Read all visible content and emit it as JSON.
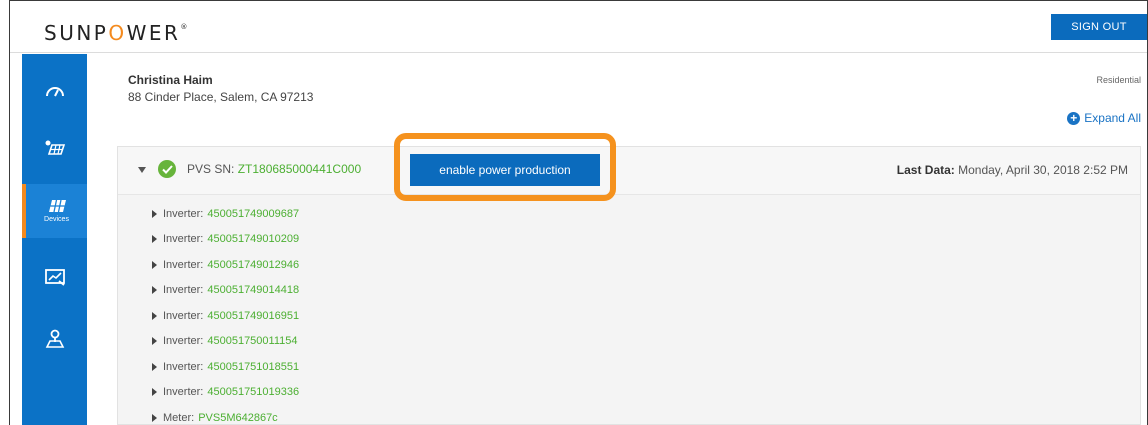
{
  "header": {
    "logo_pre": "SUNP",
    "logo_o": "O",
    "logo_post": "WER",
    "logo_reg": "®",
    "signout_label": "SIGN OUT"
  },
  "sidebar": {
    "items": [
      {
        "icon": "dashboard-gauge-icon",
        "label": ""
      },
      {
        "icon": "solar-panel-icon",
        "label": ""
      },
      {
        "icon": "devices-icon",
        "label": "Devices",
        "active": true
      },
      {
        "icon": "monitor-chart-icon",
        "label": ""
      },
      {
        "icon": "site-location-icon",
        "label": ""
      }
    ]
  },
  "customer": {
    "name": "Christina Haim",
    "address": "88 Cinder Place, Salem, CA 97213",
    "type": "Residential"
  },
  "actions": {
    "expand_all": "Expand All",
    "enable_power": "enable power production"
  },
  "pvs": {
    "label": "PVS SN: ",
    "serial": "ZT180685000441C000",
    "last_data_label": "Last Data:",
    "last_data_value": " Monday, April 30, 2018 2:52 PM"
  },
  "devices": [
    {
      "label": "Inverter:",
      "serial": "450051749009687"
    },
    {
      "label": "Inverter:",
      "serial": "450051749010209"
    },
    {
      "label": "Inverter:",
      "serial": "450051749012946"
    },
    {
      "label": "Inverter:",
      "serial": "450051749014418"
    },
    {
      "label": "Inverter:",
      "serial": "450051749016951"
    },
    {
      "label": "Inverter:",
      "serial": "450051750011154"
    },
    {
      "label": "Inverter:",
      "serial": "450051751018551"
    },
    {
      "label": "Inverter:",
      "serial": "450051751019336"
    },
    {
      "label": "Meter:",
      "serial": "PVS5M642867c"
    }
  ],
  "colors": {
    "brand_blue": "#0b6bbd",
    "sidebar_blue": "#0b72c6",
    "highlight_orange": "#f5921e",
    "serial_green": "#4caf32",
    "status_green": "#67b43b"
  }
}
